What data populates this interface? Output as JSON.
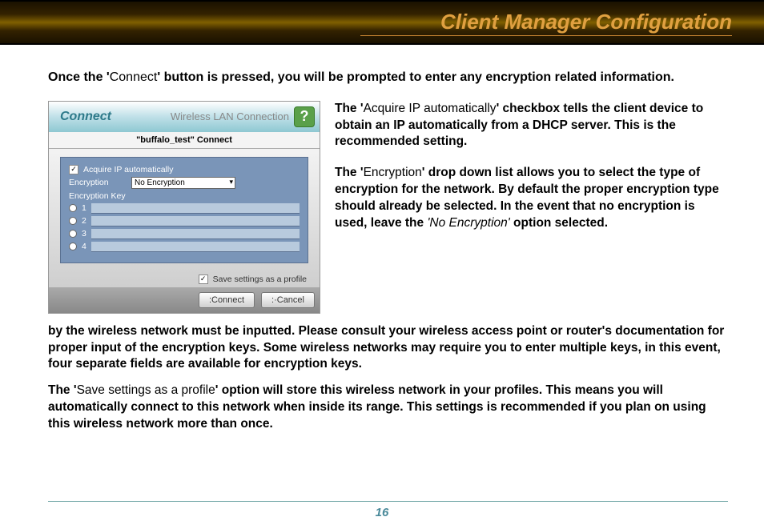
{
  "header": {
    "title": "Client Manager Configuration"
  },
  "intro": {
    "pre": "Once the '",
    "thin": "Connect",
    "post": "' button is pressed, you will be prompted to enter any encryption related information."
  },
  "dialog": {
    "connect_label": "Connect",
    "subtitle": "Wireless LAN Connection",
    "help": "?",
    "network_line": "\"buffalo_test\"  Connect",
    "acquire_label": "Acquire IP automatically",
    "encryption_label": "Encryption",
    "encryption_value": "No Encryption",
    "enc_key_label": "Encryption Key",
    "keys": [
      "1",
      "2",
      "3",
      "4"
    ],
    "save_label": "Save settings as a profile",
    "btn_connect": ":Connect",
    "btn_cancel": ":·Cancel"
  },
  "side": {
    "p1_pre": "The '",
    "p1_thin": "Acquire IP automatically",
    "p1_post": "' checkbox tells the client device to obtain an IP automatically from a DHCP server.  This is the recommended setting.",
    "p2_pre": "The '",
    "p2_thin": "Encryption",
    "p2_mid": "' drop down list allows you to select the type of encryption for the network.  By default the proper encryption type should already be selected.  In the event that no encryption is used, leave the ",
    "p2_ital": "'No Encryption'",
    "p2_post": " option selected."
  },
  "below": {
    "p1": "by the wireless network must be inputted.  Please consult your wireless access point or router's documentation for proper input of the encryption keys.  Some wireless networks may require you to enter multiple keys, in this event, four separate fields are available for encryption keys.",
    "p2_pre": "The '",
    "p2_thin": "Save settings as a profile",
    "p2_post": "' option will store this wireless network in your profiles.  This means you will automatically connect to this network when inside its range.  This settings is recommended if you plan on using this wireless network more than once."
  },
  "page_number": "16"
}
